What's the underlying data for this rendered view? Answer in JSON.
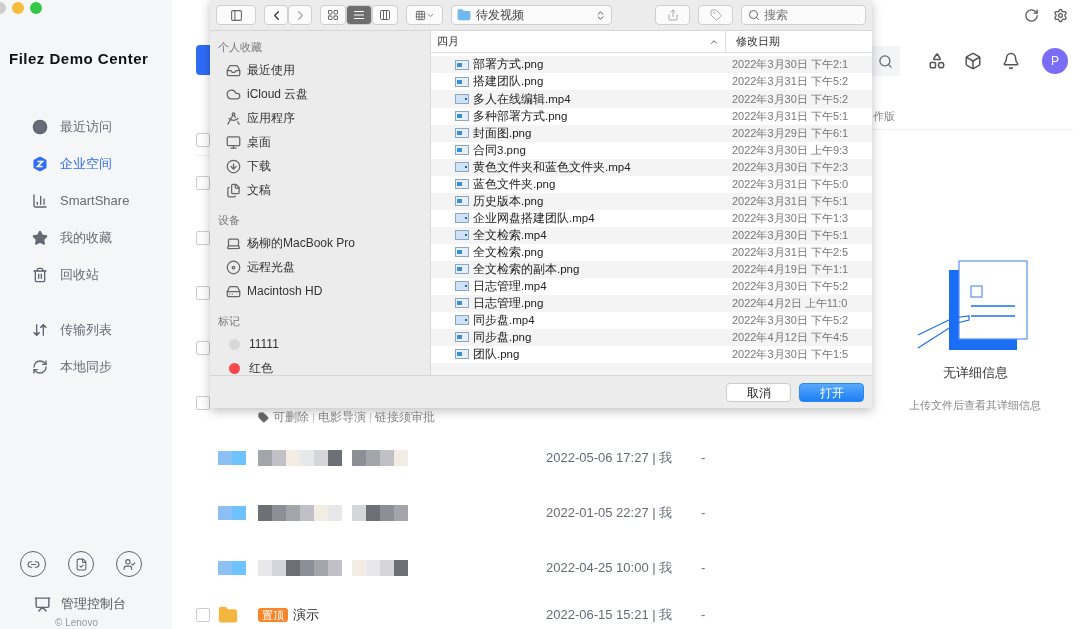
{
  "sidebar": {
    "title": "Filez Demo Center",
    "nav": [
      {
        "label": "最近访问",
        "selected": false
      },
      {
        "label": "企业空间",
        "selected": true
      },
      {
        "label": "SmartShare",
        "selected": false
      },
      {
        "label": "我的收藏",
        "selected": false
      },
      {
        "label": "回收站",
        "selected": false
      }
    ],
    "tools": [
      {
        "label": "传输列表",
        "selected": false
      },
      {
        "label": "本地同步",
        "selected": false
      }
    ],
    "console": "管理控制台",
    "copyright": "© Lenovo"
  },
  "main": {
    "header_checked": false,
    "rows": [
      {
        "kind": "hidden",
        "checked": false
      },
      {
        "kind": "hidden",
        "checked": false
      },
      {
        "kind": "hidden",
        "checked": false
      },
      {
        "kind": "hidden",
        "checked": false
      },
      {
        "kind": "tagged",
        "checked": false,
        "tags": [
          "可删除",
          "电影导演",
          "链接须审批"
        ]
      },
      {
        "kind": "blurred",
        "date": "2022-05-06 17:27 | 我",
        "size": "-"
      },
      {
        "kind": "blurred",
        "date": "2022-01-05 22:27 | 我",
        "size": "-"
      },
      {
        "kind": "blurred",
        "date": "2022-04-25 10:00 | 我",
        "size": "-"
      },
      {
        "kind": "folder",
        "checked": false,
        "badge": "置顶",
        "name": "演示",
        "date": "2022-06-15 15:21 | 我",
        "size": "-"
      }
    ]
  },
  "detail": {
    "column_fragment": "作版",
    "empty_title": "无详细信息",
    "empty_hint": "上传文件后查看其详细信息",
    "avatar": "P"
  },
  "dialog": {
    "view_modes": [
      {
        "selected": false
      },
      {
        "selected": true
      },
      {
        "selected": false
      }
    ],
    "path": "待发视频",
    "search": {
      "placeholder": "搜索"
    },
    "sections": [
      {
        "title": "个人收藏",
        "items": [
          {
            "label": "最近使用"
          },
          {
            "label": "iCloud 云盘"
          },
          {
            "label": "应用程序"
          },
          {
            "label": "桌面"
          },
          {
            "label": "下载"
          },
          {
            "label": "文稿"
          }
        ]
      },
      {
        "title": "设备",
        "items": [
          {
            "label": "杨柳的MacBook Pro"
          },
          {
            "label": "远程光盘"
          },
          {
            "label": "Macintosh HD"
          }
        ]
      },
      {
        "title": "标记",
        "items": [
          {
            "label": "11111",
            "color": "#d8d8d8"
          },
          {
            "label": "红色",
            "color": "#f5494b"
          }
        ]
      }
    ],
    "columns": [
      "四月",
      "修改日期"
    ],
    "files": [
      {
        "name": "部署方式.png",
        "kind": "image",
        "date": "2022年3月30日 下午2:1"
      },
      {
        "name": "搭建团队.png",
        "kind": "image",
        "date": "2022年3月31日 下午5:2"
      },
      {
        "name": "多人在线编辑.mp4",
        "kind": "video",
        "date": "2022年3月30日 下午5:2"
      },
      {
        "name": "多种部署方式.png",
        "kind": "image",
        "date": "2022年3月31日 下午5:1"
      },
      {
        "name": "封面图.png",
        "kind": "image",
        "date": "2022年3月29日 下午6:1"
      },
      {
        "name": "合同3.png",
        "kind": "image",
        "date": "2022年3月30日 上午9:3"
      },
      {
        "name": "黄色文件夹和蓝色文件夹.mp4",
        "kind": "video",
        "date": "2022年3月30日 下午2:3"
      },
      {
        "name": "蓝色文件夹.png",
        "kind": "image",
        "date": "2022年3月31日 下午5:0"
      },
      {
        "name": "历史版本.png",
        "kind": "image",
        "date": "2022年3月31日 下午5:1"
      },
      {
        "name": "企业网盘搭建团队.mp4",
        "kind": "video",
        "date": "2022年3月30日 下午1:3"
      },
      {
        "name": "全文检索.mp4",
        "kind": "video",
        "date": "2022年3月30日 下午5:1"
      },
      {
        "name": "全文检索.png",
        "kind": "image",
        "date": "2022年3月31日 下午2:5"
      },
      {
        "name": "全文检索的副本.png",
        "kind": "image",
        "date": "2022年4月19日 下午1:1"
      },
      {
        "name": "日志管理.mp4",
        "kind": "video",
        "date": "2022年3月30日 下午5:2"
      },
      {
        "name": "日志管理.png",
        "kind": "image",
        "date": "2022年4月2日 上午11:0"
      },
      {
        "name": "同步盘.mp4",
        "kind": "video",
        "date": "2022年3月30日 下午5:2"
      },
      {
        "name": "同步盘.png",
        "kind": "image",
        "date": "2022年4月12日 下午4:5"
      },
      {
        "name": "团队.png",
        "kind": "image",
        "date": "2022年3月30日 下午1:5"
      }
    ],
    "buttons": [
      {
        "label": "取消",
        "kind": "secondary"
      },
      {
        "label": "打开",
        "kind": "primary"
      }
    ]
  }
}
